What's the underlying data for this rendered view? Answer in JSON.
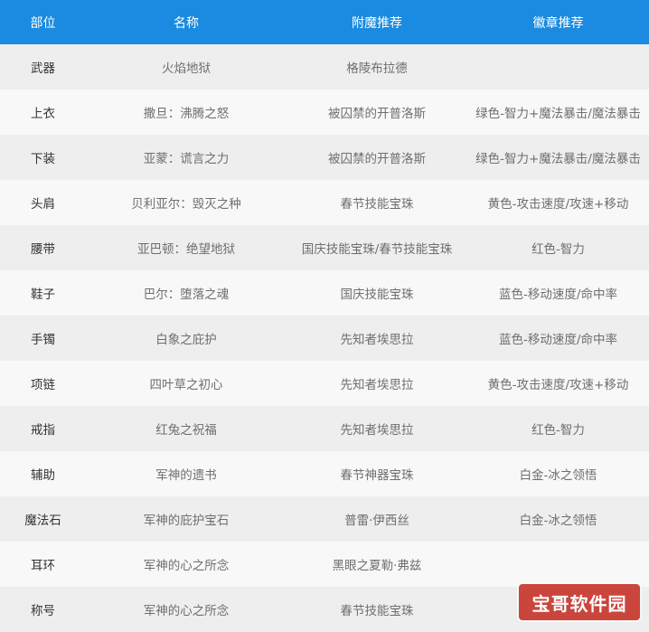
{
  "headers": [
    "部位",
    "名称",
    "附魔推荐",
    "徽章推荐"
  ],
  "rows": [
    [
      "武器",
      "火焰地狱",
      "格陵布拉德",
      ""
    ],
    [
      "上衣",
      "撒旦：沸腾之怒",
      "被囚禁的开普洛斯",
      "绿色-智力+魔法暴击/魔法暴击"
    ],
    [
      "下装",
      "亚蒙：谎言之力",
      "被囚禁的开普洛斯",
      "绿色-智力+魔法暴击/魔法暴击"
    ],
    [
      "头肩",
      "贝利亚尔：毁灭之种",
      "春节技能宝珠",
      "黄色-攻击速度/攻速+移动"
    ],
    [
      "腰带",
      "亚巴顿：绝望地狱",
      "国庆技能宝珠/春节技能宝珠",
      "红色-智力"
    ],
    [
      "鞋子",
      "巴尔：堕落之魂",
      "国庆技能宝珠",
      "蓝色-移动速度/命中率"
    ],
    [
      "手镯",
      "白象之庇护",
      "先知者埃思拉",
      "蓝色-移动速度/命中率"
    ],
    [
      "项链",
      "四叶草之初心",
      "先知者埃思拉",
      "黄色-攻击速度/攻速+移动"
    ],
    [
      "戒指",
      "红兔之祝福",
      "先知者埃思拉",
      "红色-智力"
    ],
    [
      "辅助",
      "军神的遗书",
      "春节神器宝珠",
      "白金-冰之领悟"
    ],
    [
      "魔法石",
      "军神的庇护宝石",
      "普雷·伊西丝",
      "白金-冰之领悟"
    ],
    [
      "耳环",
      "军神的心之所念",
      "黑眼之夏勒·弗兹",
      ""
    ],
    [
      "称号",
      "军神的心之所念",
      "春节技能宝珠",
      ""
    ]
  ],
  "watermark": "宝哥软件园",
  "colors": {
    "header_bg": "#1a8be0",
    "row_odd_bg": "#eeeeee",
    "row_even_bg": "#f8f8f8",
    "watermark_bg": "#c8372d"
  }
}
